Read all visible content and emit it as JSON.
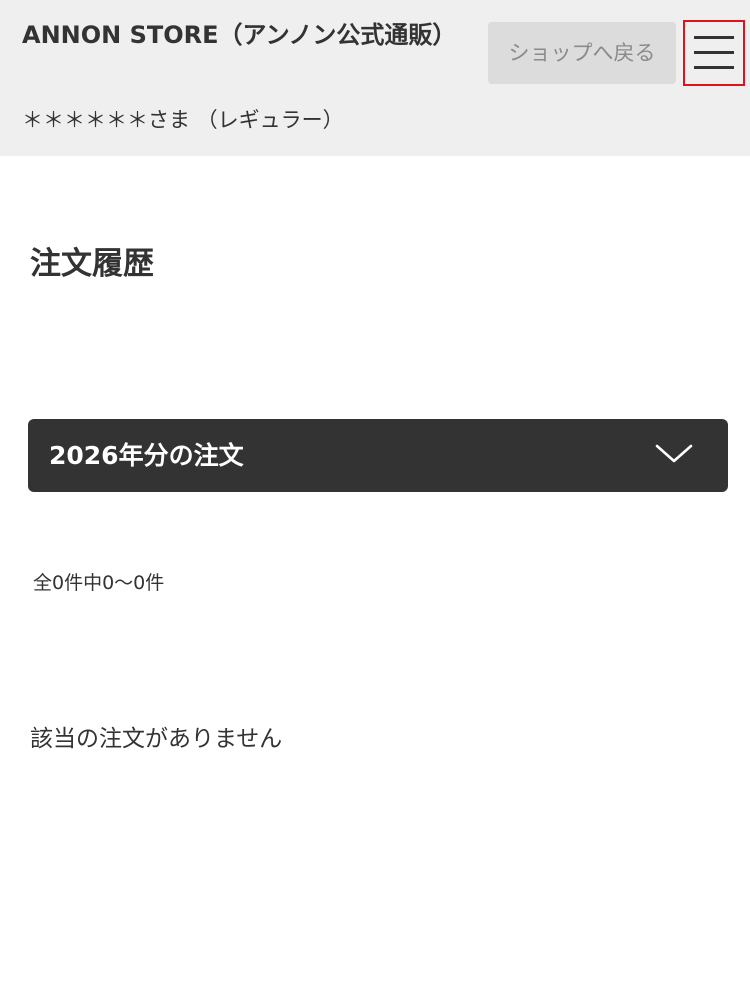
{
  "header": {
    "store_name": "ANNON STORE（アンノン公式通販）",
    "back_button_label": "ショップへ戻る",
    "user_line": "＊＊＊＊＊＊さま （レギュラー）",
    "menu_icon": "hamburger-menu-icon",
    "menu_highlight_color": "#e0121e"
  },
  "main": {
    "page_title": "注文履歴",
    "year_select": {
      "selected_label": "2026年分の注文",
      "icon": "chevron-down-icon"
    },
    "count_text": "全0件中0～0件",
    "empty_message": "該当の注文がありません"
  }
}
